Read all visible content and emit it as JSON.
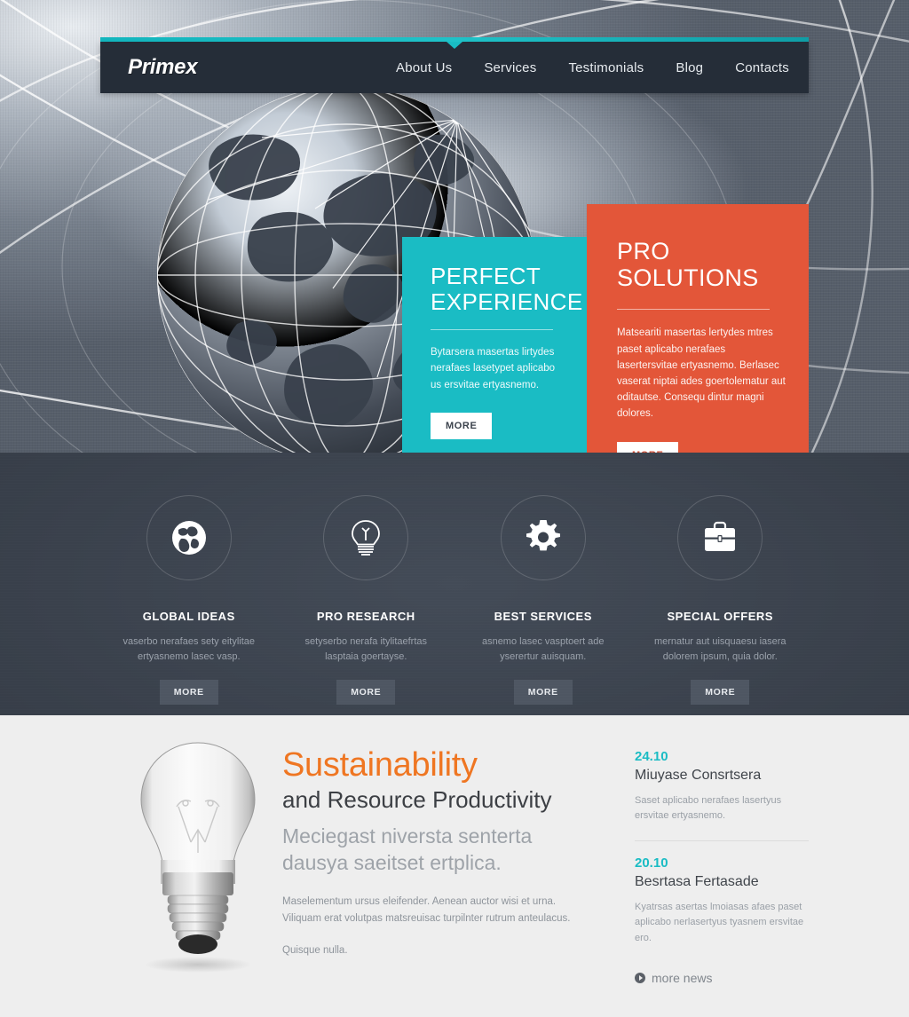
{
  "colors": {
    "teal": "#1abcc4",
    "orange": "#e35639",
    "heading_orange": "#ef7622",
    "dark_nav": "#252d38",
    "dark_section": "#3a414c",
    "light_section": "#eeeeee"
  },
  "header": {
    "logo": "Primex",
    "nav": [
      {
        "label": "About Us"
      },
      {
        "label": "Services"
      },
      {
        "label": "Testimonials"
      },
      {
        "label": "Blog"
      },
      {
        "label": "Contacts"
      }
    ]
  },
  "hero": {
    "panels": [
      {
        "title": "PERFECT\nEXPERIENCE",
        "title_line1": "PERFECT",
        "title_line2": "EXPERIENCE",
        "text": "Bytarsera masertas lirtydes nerafaes lasetypet aplicabo us ersvitae ertyasnemo.",
        "button": "MORE"
      },
      {
        "title_line1": "PRO",
        "title_line2": "SOLUTIONS",
        "text": "Matseariti masertas lertydes mtres paset aplicabo nerafaes lasertersvitae ertyasnemo. Berlasec vaserat niptai ades goertolematur aut oditautse. Consequ dintur magni dolores.",
        "button": "MORE"
      }
    ]
  },
  "features": [
    {
      "icon": "globe-icon",
      "title": "GLOBAL IDEAS",
      "text": "vaserbo nerafaes sety eitylitae ertyasnemo lasec vasp.",
      "button": "MORE"
    },
    {
      "icon": "lightbulb-icon",
      "title": "PRO RESEARCH",
      "text": "setyserbo nerafa itylitaefrtas lasptaia goertayse.",
      "button": "MORE"
    },
    {
      "icon": "gear-icon",
      "title": "BEST SERVICES",
      "text": "asnemo lasec vasptoert ade yserertur auisquam.",
      "button": "MORE"
    },
    {
      "icon": "briefcase-icon",
      "title": "SPECIAL OFFERS",
      "text": "mernatur aut uisquaesu iasera dolorem ipsum, quia dolor.",
      "button": "MORE"
    }
  ],
  "content": {
    "heading_orange": "Sustainability",
    "heading_dark": "and Resource Productivity",
    "heading_grey": "Meciegast niversta senterta dausya saeitset ertplica.",
    "paragraph1": "Maselementum ursus eleifender. Aenean auctor wisi et urna. Viliquam erat volutpas matsreuisac turpilnter rutrum anteulacus.",
    "paragraph2": "Quisque nulla.",
    "image_alt": "lightbulb-photo"
  },
  "news": {
    "items": [
      {
        "date": "24.10",
        "title": "Miuyase Consrtsera",
        "text": "Saset aplicabo nerafaes lasertyus ersvitae ertyasnemo."
      },
      {
        "date": "20.10",
        "title": "Besrtasa Fertasade",
        "text": "Kyatrsas asertas lmoiasas afaes paset aplicabo nerlasertyus tyasnem ersvitae ero."
      }
    ],
    "more_link": "more news"
  }
}
